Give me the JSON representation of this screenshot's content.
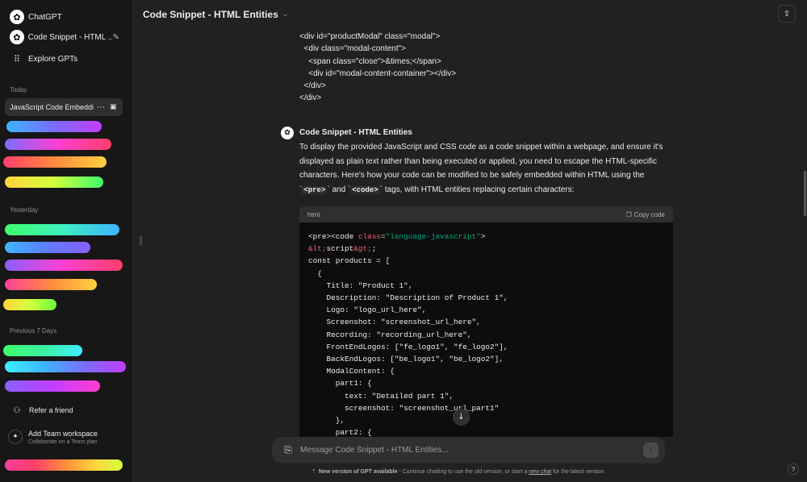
{
  "sidebar": {
    "app_name": "ChatGPT",
    "current_chat_title": "Code Snippet - HTML ...",
    "explore_label": "Explore GPTs",
    "sections": {
      "today": "Today",
      "yesterday": "Yesterday",
      "previous7": "Previous 7 Days"
    },
    "active_chat_label": "JavaScript Code Embedding",
    "redacted_colors": [
      "#7b6cff",
      "#ff3fd0",
      "#ff8a3d",
      "#3dff6a",
      "#3df0ff",
      "#c13dff"
    ],
    "refer_label": "Refer a friend",
    "team": {
      "title": "Add Team workspace",
      "subtitle": "Collaborate on a Team plan"
    }
  },
  "header": {
    "title": "Code Snippet - HTML Entities"
  },
  "conversation": {
    "user_code_lines": "<div id=\"productModal\" class=\"modal\">\n  <div class=\"modal-content\">\n    <span class=\"close\">&times;</span>\n    <div id=\"modal-content-container\"></div>\n  </div>\n</div>",
    "assistant_name": "Code Snippet - HTML Entities",
    "paragraph_main": "To display the provided JavaScript and CSS code as a code snippet within a webpage, and ensure it's displayed as plain text rather than being executed or applied, you need to escape the HTML-specific characters. Here's how your code can be modified to be safely embedded within HTML using the ",
    "tag_pre": "<pre>",
    "and_word": "and",
    "tag_code": "<code>",
    "paragraph_end": "tags, with HTML entities replacing certain characters:",
    "code_block": {
      "language": "html",
      "copy_label": "Copy code",
      "line1_prefix": "<pre><code ",
      "line1_attr": "class",
      "line1_value": "\"language-javascript\"",
      "line1_suffix": ">",
      "line2_ent1": "&lt;",
      "line2_mid": "script",
      "line2_ent2": "&gt;",
      "line2_end": ";",
      "rest": "const products = [\n  {\n    Title: \"Product 1\",\n    Description: \"Description of Product 1\",\n    Logo: \"logo_url_here\",\n    Screenshot: \"screenshot_url_here\",\n    Recording: \"recording_url_here\",\n    FrontEndLogos: [\"fe_logo1\", \"fe_logo2\"],\n    BackEndLogos: [\"be_logo1\", \"be_logo2\"],\n    ModalContent: {\n      part1: {\n        text: \"Detailed part 1\",\n        screenshot: \"screenshot_url_part1\"\n      },\n      part2: {"
    }
  },
  "composer": {
    "placeholder": "Message Code Snippet - HTML Entities..."
  },
  "footer": {
    "bold": "New version of GPT available",
    "middle": " - Continue chatting to use the old version, or start a ",
    "link": "new chat",
    "end": " for the latest version."
  },
  "help_label": "?"
}
